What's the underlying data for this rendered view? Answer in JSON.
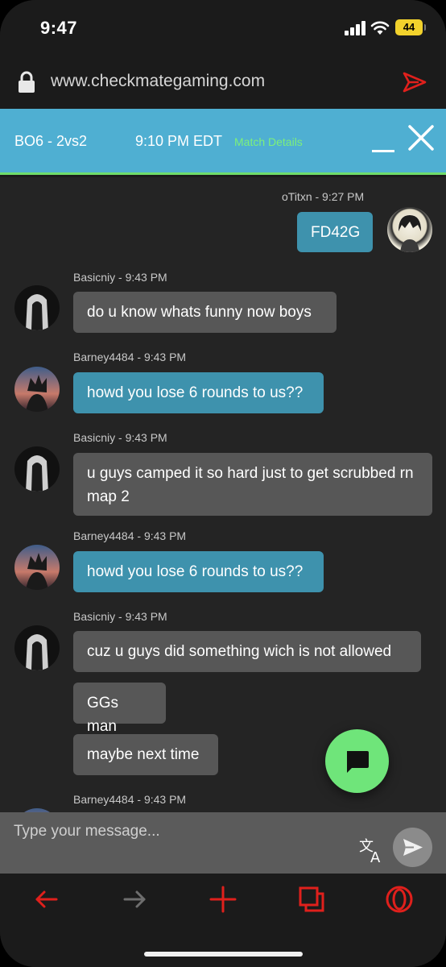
{
  "status_bar": {
    "time": "9:47",
    "battery": "44",
    "icons": [
      "cellular-signal-icon",
      "wifi-icon",
      "battery-charging-icon"
    ]
  },
  "browser": {
    "url": "www.checkmategaming.com",
    "icons": [
      "lock-icon",
      "send-arrow-icon"
    ]
  },
  "chat_header": {
    "game": "BO6 - 2vs2",
    "time": "9:10 PM EDT",
    "details_link": "Match Details"
  },
  "messages": [
    {
      "author_line": "oTitxn - 9:27 PM",
      "side": "right",
      "style": "blue",
      "texts": [
        "FD42G"
      ]
    },
    {
      "author_line": "Basicniy - 9:43 PM",
      "side": "left",
      "style": "gray",
      "texts": [
        "do u know whats funny now boys"
      ]
    },
    {
      "author_line": "Barney4484 - 9:43 PM",
      "side": "left",
      "style": "blue",
      "texts": [
        "howd you lose 6 rounds to us??"
      ]
    },
    {
      "author_line": "Basicniy - 9:43 PM",
      "side": "left",
      "style": "gray",
      "texts": [
        "u guys camped it so hard just to get scrubbed rn map 2"
      ]
    },
    {
      "author_line": "Barney4484 - 9:43 PM",
      "side": "left",
      "style": "blue",
      "texts": [
        "howd you lose 6 rounds to us??"
      ]
    },
    {
      "author_line": "Basicniy - 9:43 PM",
      "side": "left",
      "style": "gray",
      "texts": [
        "cuz u guys did something wich is not allowed",
        "GGs man",
        "maybe next time"
      ]
    },
    {
      "author_line": "Barney4484 - 9:43 PM",
      "side": "left",
      "style": "blue",
      "texts": []
    }
  ],
  "composer": {
    "placeholder": "Type your message..."
  },
  "colors": {
    "header_bg": "#4fafd2",
    "accent_green": "#6fdc6a",
    "bubble_blue": "#3e92ad",
    "bubble_gray": "#575757",
    "nav_red": "#e0201c"
  },
  "toolbar_icons": [
    "back-arrow-icon",
    "forward-arrow-icon",
    "plus-icon",
    "tabs-icon",
    "opera-icon"
  ]
}
